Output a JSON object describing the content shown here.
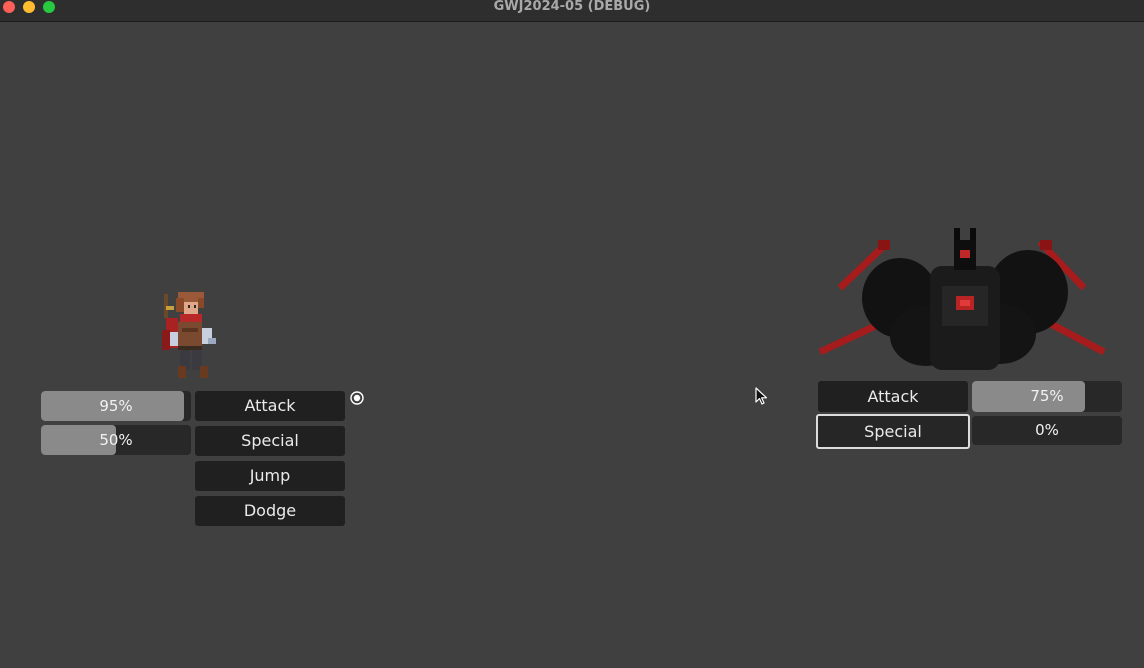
{
  "window": {
    "title": "GWJ2024-05 (DEBUG)",
    "controls": [
      "close",
      "minimize",
      "maximize"
    ]
  },
  "player": {
    "sprite": "adventurer-sprite",
    "health_bar": {
      "label": "95%",
      "value": 0.95
    },
    "special_bar": {
      "label": "50%",
      "value": 0.5
    },
    "actions": [
      "Attack",
      "Special",
      "Jump",
      "Dodge"
    ],
    "selector_icon": "target-icon"
  },
  "enemy": {
    "sprite": "winged-demon-sprite",
    "actions": [
      "Attack",
      "Special"
    ],
    "focused_action": "Special",
    "health_bar": {
      "label": "75%",
      "value": 0.75
    },
    "special_bar": {
      "label": "0%",
      "value": 0.0
    }
  },
  "mouse_cursor_icon": "mouse-pointer-icon",
  "colors": {
    "background": "#404040",
    "bar_track": "#282828",
    "bar_fill": "#8a8a8a",
    "button": "#202020",
    "accent_red": "#b01e1e"
  }
}
